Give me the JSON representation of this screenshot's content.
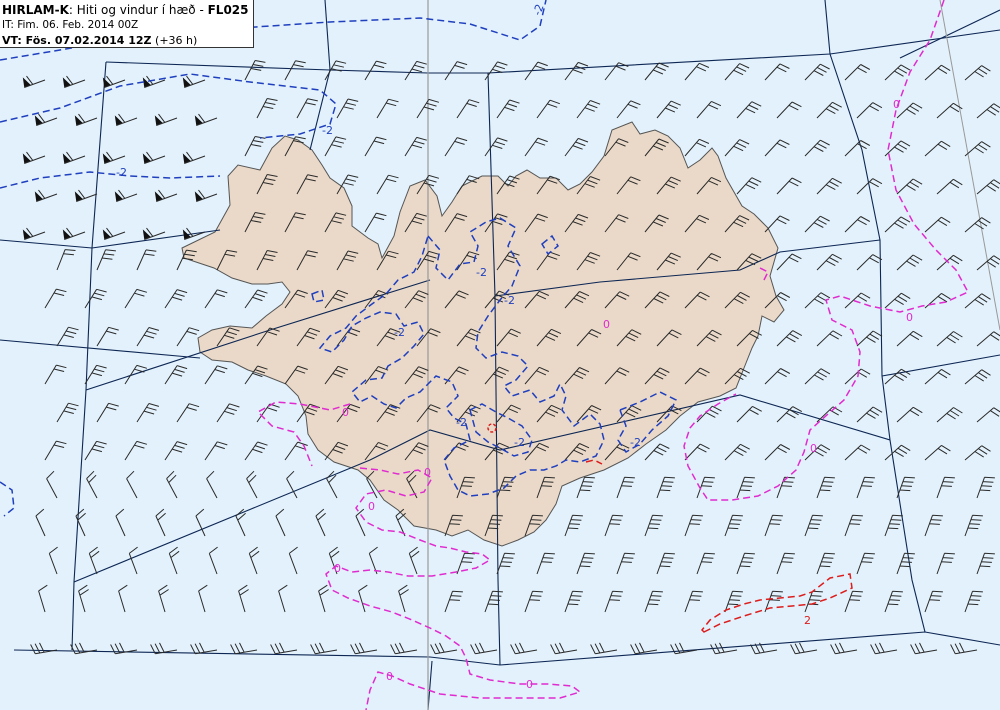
{
  "header": {
    "model": "HIRLAM-K",
    "title_rest": ": Hiti og vindur í hæð - ",
    "level": "FL025",
    "it_line": "IT: Fim. 06. Feb. 2014 00Z",
    "vt_label": "VT: Fös. 07.02.2014 12Z",
    "vt_offset": " (+36 h)"
  },
  "contour_labels": {
    "minus2": "-2",
    "zero": "0",
    "plus2": "2"
  },
  "colors": {
    "sea": "#e2f1fb",
    "land": "#ead9c8",
    "coast": "#555555",
    "grid": "#0d2654",
    "meridian": "#999999",
    "contour_neg": "#1f3fbf",
    "contour_zero": "#e02bd0",
    "contour_pos": "#dd1c1c",
    "barb": "#2a2a2a"
  }
}
